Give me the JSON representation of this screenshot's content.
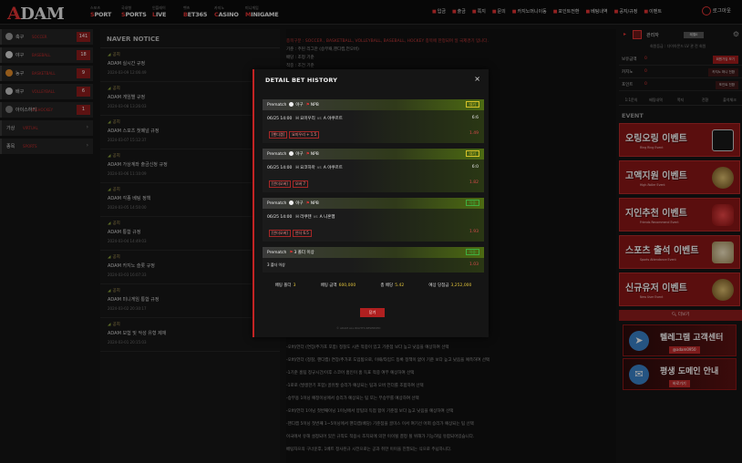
{
  "header": {
    "logo_a": "A",
    "logo_rest": "DAM",
    "nav": [
      {
        "sub": "스포츠",
        "main_first": "S",
        "main_rest": "PORT"
      },
      {
        "sub": "국내형",
        "main_first": "S",
        "main_rest": "PORTS"
      },
      {
        "sub": "인플레이",
        "main_first": "L",
        "main_rest": "IVE"
      },
      {
        "sub": "벳츠",
        "main_first": "B",
        "main_rest": "ET365"
      },
      {
        "sub": "카지노",
        "main_first": "C",
        "main_rest": "ASINO"
      },
      {
        "sub": "미니게임",
        "main_first": "M",
        "main_rest": "INIGAME"
      }
    ],
    "menu": [
      "입금",
      "출금",
      "쪽지",
      "문의",
      "카지노머니이동",
      "포인트전환",
      "베팅내역",
      "공지/규정",
      "이벤트"
    ],
    "login": "로그아웃"
  },
  "sidebar": [
    {
      "name": "축구",
      "sub": "SOCCER",
      "count": "141",
      "color": "#9a9a9a"
    },
    {
      "name": "야구",
      "sub": "BASEBALL",
      "count": "18",
      "color": "#d8d8d8"
    },
    {
      "name": "농구",
      "sub": "BASKETBALL",
      "count": "9",
      "color": "#e08a2a"
    },
    {
      "name": "배구",
      "sub": "VOLLEYBALL",
      "count": "6",
      "color": "#c8c8c8"
    },
    {
      "name": "아이스하키",
      "sub": "ICEHOCKEY",
      "count": "1",
      "color": "#7a7a7a"
    },
    {
      "name": "가상",
      "sub": "VIRTUAL",
      "count": "",
      "color": ""
    },
    {
      "name": "종목",
      "sub": "SPORTS",
      "count": "",
      "color": ""
    }
  ],
  "notice": {
    "title": "NAVER NOTICE",
    "rows": [
      {
        "tag": "공지",
        "title": "ADAM 실시간 규정",
        "date": "2024-03-09 12:06:49"
      },
      {
        "tag": "공지",
        "title": "ADAM 게임별 규정",
        "date": "2024-03-08 13:26:03"
      },
      {
        "tag": "공지",
        "title": "ADAM 스포츠 첫폐널 규정",
        "date": "2024-03-07 15:12:37"
      },
      {
        "tag": "공지",
        "title": "ADAM 가상계좌 출금신청 규정",
        "date": "2024-03-06 11:10:09"
      },
      {
        "tag": "공지",
        "title": "ADAM 각종 베팅 정책",
        "date": "2024-03-05 14:50:00"
      },
      {
        "tag": "공지",
        "title": "ADAM 통합 규정",
        "date": "2024-03-04 14:49:03"
      },
      {
        "tag": "공지",
        "title": "ADAM 카지노 슬롯 규정",
        "date": "2024-03-03 16:07:33"
      },
      {
        "tag": "공지",
        "title": "ADAM 미니게임 통합 규정",
        "date": "2024-03-02 20:30:17"
      },
      {
        "tag": "공지",
        "title": "ADAM 보험 및 악성 유형 제재",
        "date": "2024-03-01 20:15:03"
      }
    ]
  },
  "content": {
    "lines_top": [
      "종목구분 : SOCCER , BASKETBALL, VOLLEYBALL, BASEBALL, HOCKEY 종목에 한정되며 일 국제경기 입니다.",
      "기준 : 주된 리그만 (승무패,핸디캡,언오버)",
      "배당 : 조정 기준",
      "적중 : 조건 기준"
    ],
    "lines_bottom": [
      "-오버/언더 (연장/추가포 포함) 정찰도 시즌 적중이 있고 기준점 보다 높고 낮음을 예상하여 선택",
      "-오버/언더 (정찰, 핸디캡) 연장/추가포 도입됨으로, 이때/타임드 등록 정책이 없이 기준 보다 높고 낮음을 예측하여 선택",
      "-1기준 홈팀 정규시간/이후 스코어 홈인이 홈 득표 적중 여부 예상하여 선택",
      "-1로로 (발생한기 포함) 골유발 승리가 예상되는 팀과 오버 언더를 조합하여 선택",
      "-승부용 1이닝 예정이닝에서 승리가 예상되는 팀 또는 무승부를 예상하여 선택",
      "-오버/언더 1이닝 첫번째이닝 1이닝에서 양팀의 득점 합이 기준점 보다 높고 낮음을 예상하여 선택",
      "-핸디캡 5이닝 첫번째 1~5이닝에서 핸디캡(배당) 기준점을 골미스 이서 여기선 어떠 승리가 예상되는 팀 선택",
      "이국에서 유해 설정되어 있은 규칙도 적용시 조치되에 의한 이이될 결정 될 위해가 기능하팀 유합되어있습니다.",
      "베팅자으의 구너운후, 1베트 정사된규 시전으로는 공과 취한 이이을 진열되는 식으로 주닙하니다."
    ]
  },
  "right": {
    "user": "관리자",
    "badge": "레벨0",
    "level": "회원등급 : 다이아몬드 LV 관 전 회원",
    "rows": [
      {
        "k": "보유금액",
        "v": "0",
        "btn": "회원가입 보기"
      },
      {
        "k": "카지노",
        "v": "0",
        "btn": "카지노 머니 전환"
      },
      {
        "k": "포인트",
        "v": "0",
        "btn": "포인트 전환"
      }
    ],
    "tabs": [
      "1:1문의",
      "배팅내역",
      "쪽지",
      "전환",
      "출석체크"
    ],
    "event_title": "EVENT",
    "events": [
      {
        "title": "오링오링 이벤트",
        "sub": "Ring Ring Event",
        "deco": "card"
      },
      {
        "title": "고액지원 이벤트",
        "sub": "High-Roller Event",
        "deco": "coin"
      },
      {
        "title": "지인추천 이벤트",
        "sub": "Friends Recommend Event",
        "deco": "heart"
      },
      {
        "title": "스포츠 출석 이벤트",
        "sub": "Sports Attendance Event",
        "deco": "hex"
      },
      {
        "title": "신규유저 이벤트",
        "sub": "New User Event",
        "deco": "coin"
      }
    ],
    "more": "더보기",
    "banners": [
      {
        "title": "텔레그램 고객센터",
        "sub": "@adam0950",
        "icon": "➤"
      },
      {
        "title": "평생 도메인 안내",
        "sub": "바로가기",
        "icon": "✉"
      }
    ]
  },
  "modal": {
    "title": "DETAIL BET HISTORY",
    "bets": [
      {
        "type": "Prematch",
        "sport": "야구",
        "league": "NPB",
        "status": "대기",
        "status_color": "y",
        "time": "06/25 14:00",
        "home": "H 요미우리",
        "away": "A 야쿠르트",
        "score": "6:6",
        "pick_label": "[핸디캡]",
        "pick_value": "요미우리 + 1.5",
        "odds": "1.49"
      },
      {
        "type": "Prematch",
        "sport": "야구",
        "league": "NPB",
        "status": "대기",
        "status_color": "y",
        "time": "06/25 14:00",
        "home": "H 요코하마",
        "away": "A 야쿠르트",
        "score": "6:0",
        "pick_label": "[언더오버]",
        "pick_value": "오버 7",
        "odds": "1.82"
      },
      {
        "type": "Prematch",
        "sport": "야구",
        "league": "NPB",
        "status": "적중",
        "status_color": "g",
        "time": "06/25 14:00",
        "home": "H 라쿠텐",
        "away": "A 니혼햄",
        "score": "",
        "pick_label": "[언더오버]",
        "pick_value": "언더 6.5",
        "odds": "1.93"
      },
      {
        "type": "Prematch",
        "sport": "",
        "league": "3 폴더 이상",
        "status": "적중",
        "status_color": "g",
        "time": "",
        "home": "",
        "away": "",
        "score": "",
        "pick_label": "3 폴더 이상",
        "pick_value": "",
        "odds": "1.03"
      }
    ],
    "summary": {
      "folder_label": "배팅 폴더",
      "folder": "3",
      "amount_label": "배팅 금액",
      "amount": "600,000",
      "total_label": "총 배당",
      "total": "5.42",
      "win_label": "예상 당첨금",
      "win": "3,252,000"
    },
    "close": "닫기",
    "footer": "© ADAM ALL RIGHTS RESERVED"
  }
}
